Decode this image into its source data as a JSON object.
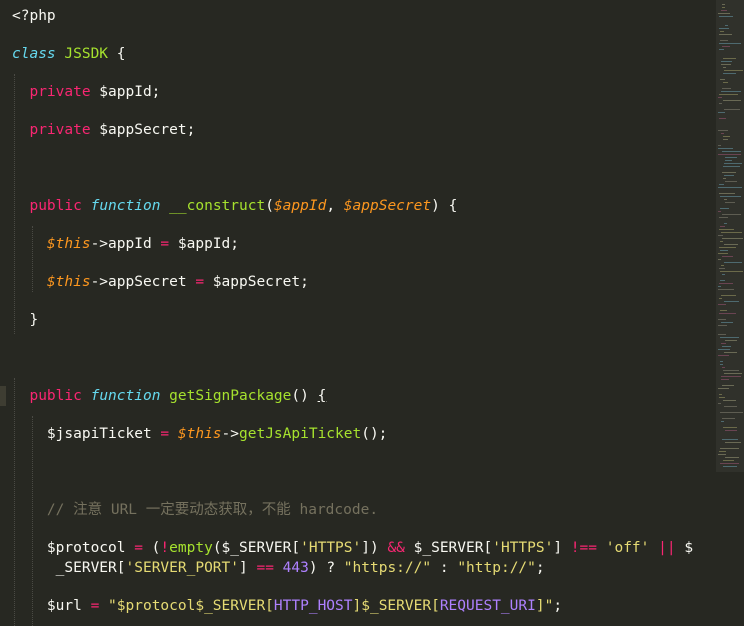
{
  "editor": {
    "language": "PHP",
    "theme_colors": {
      "background": "#272822",
      "keyword": "#f92672",
      "storage": "#66d9ef",
      "function": "#a6e22e",
      "parameter": "#fd971f",
      "string": "#e6db74",
      "number": "#ae81ff",
      "comment": "#75715e",
      "plain": "#f8f8f2"
    },
    "lines": [
      {
        "tokens": [
          {
            "t": "<?php",
            "c": "t-plain"
          }
        ]
      },
      {
        "tokens": [
          {
            "t": "class",
            "c": "t-storage"
          },
          {
            "t": " "
          },
          {
            "t": "JSSDK",
            "c": "t-cls"
          },
          {
            "t": " {"
          }
        ]
      },
      {
        "tokens": [
          {
            "t": "  "
          },
          {
            "t": "private",
            "c": "t-kw"
          },
          {
            "t": " $appId;"
          }
        ]
      },
      {
        "tokens": [
          {
            "t": "  "
          },
          {
            "t": "private",
            "c": "t-kw"
          },
          {
            "t": " $appSecret;"
          }
        ]
      },
      {
        "tokens": []
      },
      {
        "tokens": [
          {
            "t": "  "
          },
          {
            "t": "public",
            "c": "t-kw"
          },
          {
            "t": " "
          },
          {
            "t": "function",
            "c": "t-storage"
          },
          {
            "t": " "
          },
          {
            "t": "__construct",
            "c": "t-fn"
          },
          {
            "t": "("
          },
          {
            "t": "$appId",
            "c": "t-param"
          },
          {
            "t": ", "
          },
          {
            "t": "$appSecret",
            "c": "t-param"
          },
          {
            "t": ") {"
          }
        ]
      },
      {
        "tokens": [
          {
            "t": "    "
          },
          {
            "t": "$this",
            "c": "t-this"
          },
          {
            "t": "->appId "
          },
          {
            "t": "=",
            "c": "t-kw"
          },
          {
            "t": " $appId;"
          }
        ]
      },
      {
        "tokens": [
          {
            "t": "    "
          },
          {
            "t": "$this",
            "c": "t-this"
          },
          {
            "t": "->appSecret "
          },
          {
            "t": "=",
            "c": "t-kw"
          },
          {
            "t": " $appSecret;"
          }
        ]
      },
      {
        "tokens": [
          {
            "t": "  }"
          }
        ]
      },
      {
        "tokens": []
      },
      {
        "tokens": [
          {
            "t": "  "
          },
          {
            "t": "public",
            "c": "t-kw"
          },
          {
            "t": " "
          },
          {
            "t": "function",
            "c": "t-storage"
          },
          {
            "t": " "
          },
          {
            "t": "getSignPackage",
            "c": "t-fn"
          },
          {
            "t": "() "
          },
          {
            "t": "{",
            "c": "t-plain t-ul"
          }
        ]
      },
      {
        "tokens": [
          {
            "t": "    $jsapiTicket "
          },
          {
            "t": "=",
            "c": "t-kw"
          },
          {
            "t": " "
          },
          {
            "t": "$this",
            "c": "t-this"
          },
          {
            "t": "->"
          },
          {
            "t": "getJsApiTicket",
            "c": "t-fn"
          },
          {
            "t": "();"
          }
        ]
      },
      {
        "tokens": []
      },
      {
        "tokens": [
          {
            "t": "    // 注意 URL 一定要动态获取，不能 hardcode.",
            "c": "t-com"
          }
        ]
      },
      {
        "tokens": [
          {
            "t": "    $protocol "
          },
          {
            "t": "=",
            "c": "t-kw"
          },
          {
            "t": " ("
          },
          {
            "t": "!",
            "c": "t-kw"
          },
          {
            "t": "empty",
            "c": "t-fn"
          },
          {
            "t": "($_SERVER["
          },
          {
            "t": "'HTTPS'",
            "c": "t-str"
          },
          {
            "t": "]) "
          },
          {
            "t": "&&",
            "c": "t-kw"
          },
          {
            "t": " $_SERVER["
          },
          {
            "t": "'HTTPS'",
            "c": "t-str"
          },
          {
            "t": "] "
          },
          {
            "t": "!==",
            "c": "t-kw"
          },
          {
            "t": " "
          },
          {
            "t": "'off'",
            "c": "t-str"
          },
          {
            "t": " "
          },
          {
            "t": "||",
            "c": "t-kw"
          },
          {
            "t": " $"
          }
        ]
      },
      {
        "tokens": [
          {
            "t": "     _SERVER["
          },
          {
            "t": "'SERVER_PORT'",
            "c": "t-str"
          },
          {
            "t": "] "
          },
          {
            "t": "==",
            "c": "t-kw"
          },
          {
            "t": " "
          },
          {
            "t": "443",
            "c": "t-num"
          },
          {
            "t": ") ? "
          },
          {
            "t": "\"https://\"",
            "c": "t-str"
          },
          {
            "t": " : "
          },
          {
            "t": "\"http://\"",
            "c": "t-str"
          },
          {
            "t": ";"
          }
        ]
      },
      {
        "tokens": [
          {
            "t": "    $url "
          },
          {
            "t": "=",
            "c": "t-kw"
          },
          {
            "t": " "
          },
          {
            "t": "\"$protocol$_SERVER[",
            "c": "t-str"
          },
          {
            "t": "HTTP_HOST",
            "c": "t-const"
          },
          {
            "t": "]$_SERVER[",
            "c": "t-str"
          },
          {
            "t": "REQUEST_URI",
            "c": "t-const"
          },
          {
            "t": "]\"",
            "c": "t-str"
          },
          {
            "t": ";"
          }
        ]
      }
    ]
  }
}
